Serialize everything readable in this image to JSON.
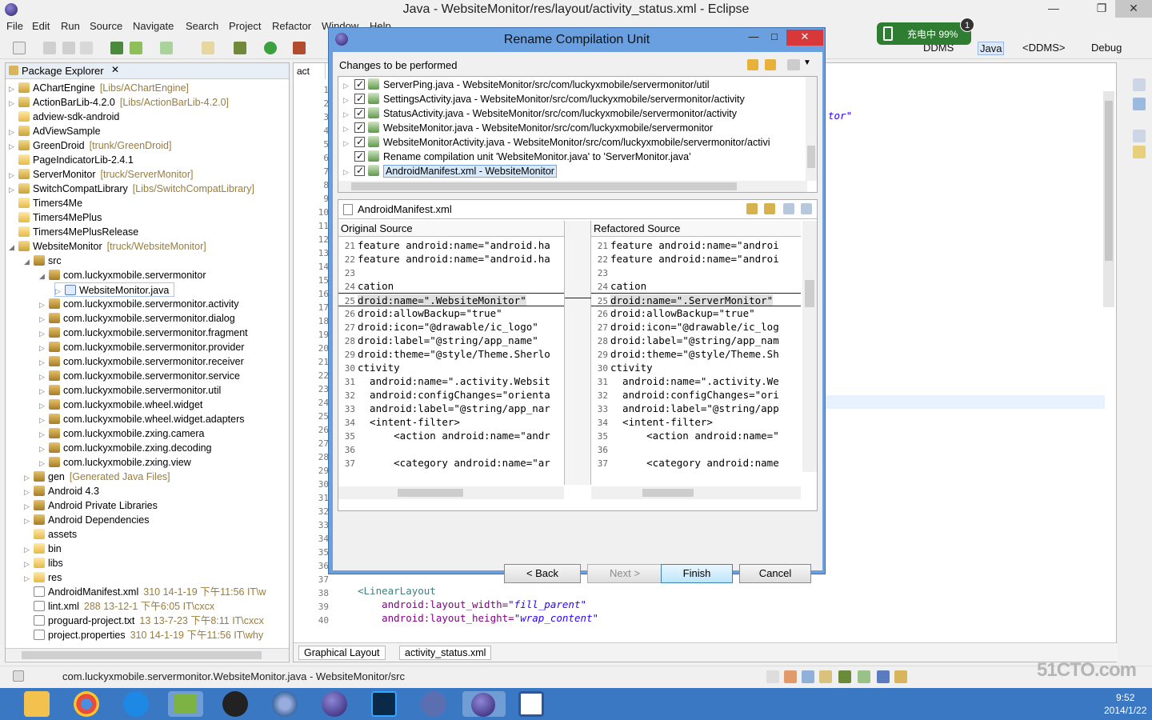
{
  "window": {
    "title": "Java - WebsiteMonitor/res/layout/activity_status.xml - Eclipse",
    "minimize": "—",
    "maximize": "❐",
    "close": "✕"
  },
  "menu": [
    "File",
    "Edit",
    "Run",
    "Source",
    "Navigate",
    "Search",
    "Project",
    "Refactor",
    "Window",
    "Help"
  ],
  "perspectives": [
    "DDMS",
    "Java",
    "<DDMS>",
    "Debug"
  ],
  "battery": {
    "label": "充电中 99%",
    "badge": "1"
  },
  "package_explorer": {
    "title": "Package Explorer",
    "close": "✕",
    "items": [
      {
        "label": "AChartEngine",
        "deco": "[Libs/AChartEngine]",
        "type": "proj",
        "indent": 0,
        "arrow": "▷"
      },
      {
        "label": "ActionBarLib-4.2.0",
        "deco": "[Libs/ActionBarLib-4.2.0]",
        "type": "proj",
        "indent": 0,
        "arrow": "▷"
      },
      {
        "label": "adview-sdk-android",
        "deco": "",
        "type": "folder",
        "indent": 0,
        "arrow": ""
      },
      {
        "label": "AdViewSample",
        "deco": "",
        "type": "proj",
        "indent": 0,
        "arrow": "▷"
      },
      {
        "label": "GreenDroid",
        "deco": "[trunk/GreenDroid]",
        "type": "proj",
        "indent": 0,
        "arrow": "▷"
      },
      {
        "label": "PageIndicatorLib-2.4.1",
        "deco": "",
        "type": "folder",
        "indent": 0,
        "arrow": ""
      },
      {
        "label": "ServerMonitor",
        "deco": "[truck/ServerMonitor]",
        "type": "proj",
        "indent": 0,
        "arrow": "▷"
      },
      {
        "label": "SwitchCompatLibrary",
        "deco": "[Libs/SwitchCompatLibrary]",
        "type": "proj",
        "indent": 0,
        "arrow": "▷"
      },
      {
        "label": "Timers4Me",
        "deco": "",
        "type": "folder",
        "indent": 0,
        "arrow": ""
      },
      {
        "label": "Timers4MePlus",
        "deco": "",
        "type": "folder",
        "indent": 0,
        "arrow": ""
      },
      {
        "label": "Timers4MePlusRelease",
        "deco": "",
        "type": "folder",
        "indent": 0,
        "arrow": ""
      },
      {
        "label": "WebsiteMonitor",
        "deco": "[truck/WebsiteMonitor]",
        "type": "proj",
        "indent": 0,
        "arrow": "◢"
      },
      {
        "label": "src",
        "deco": "",
        "type": "pkg",
        "indent": 1,
        "arrow": "◢"
      },
      {
        "label": "com.luckyxmobile.servermonitor",
        "deco": "",
        "type": "pkg",
        "indent": 2,
        "arrow": "◢"
      },
      {
        "label": "WebsiteMonitor.java",
        "deco": "",
        "type": "java",
        "indent": 3,
        "arrow": "▷",
        "selected": true
      },
      {
        "label": "com.luckyxmobile.servermonitor.activity",
        "deco": "",
        "type": "pkg",
        "indent": 2,
        "arrow": "▷"
      },
      {
        "label": "com.luckyxmobile.servermonitor.dialog",
        "deco": "",
        "type": "pkg",
        "indent": 2,
        "arrow": "▷"
      },
      {
        "label": "com.luckyxmobile.servermonitor.fragment",
        "deco": "",
        "type": "pkg",
        "indent": 2,
        "arrow": "▷"
      },
      {
        "label": "com.luckyxmobile.servermonitor.provider",
        "deco": "",
        "type": "pkg",
        "indent": 2,
        "arrow": "▷"
      },
      {
        "label": "com.luckyxmobile.servermonitor.receiver",
        "deco": "",
        "type": "pkg",
        "indent": 2,
        "arrow": "▷"
      },
      {
        "label": "com.luckyxmobile.servermonitor.service",
        "deco": "",
        "type": "pkg",
        "indent": 2,
        "arrow": "▷"
      },
      {
        "label": "com.luckyxmobile.servermonitor.util",
        "deco": "",
        "type": "pkg",
        "indent": 2,
        "arrow": "▷"
      },
      {
        "label": "com.luckyxmobile.wheel.widget",
        "deco": "",
        "type": "pkg",
        "indent": 2,
        "arrow": "▷"
      },
      {
        "label": "com.luckyxmobile.wheel.widget.adapters",
        "deco": "",
        "type": "pkg",
        "indent": 2,
        "arrow": "▷"
      },
      {
        "label": "com.luckyxmobile.zxing.camera",
        "deco": "",
        "type": "pkg",
        "indent": 2,
        "arrow": "▷"
      },
      {
        "label": "com.luckyxmobile.zxing.decoding",
        "deco": "",
        "type": "pkg",
        "indent": 2,
        "arrow": "▷"
      },
      {
        "label": "com.luckyxmobile.zxing.view",
        "deco": "",
        "type": "pkg",
        "indent": 2,
        "arrow": "▷"
      },
      {
        "label": "gen",
        "deco": "[Generated Java Files]",
        "type": "pkg",
        "indent": 1,
        "arrow": "▷"
      },
      {
        "label": "Android 4.3",
        "deco": "",
        "type": "pkg",
        "indent": 1,
        "arrow": "▷"
      },
      {
        "label": "Android Private Libraries",
        "deco": "",
        "type": "pkg",
        "indent": 1,
        "arrow": "▷"
      },
      {
        "label": "Android Dependencies",
        "deco": "",
        "type": "pkg",
        "indent": 1,
        "arrow": "▷"
      },
      {
        "label": "assets",
        "deco": "",
        "type": "folder",
        "indent": 1,
        "arrow": ""
      },
      {
        "label": "bin",
        "deco": "",
        "type": "folder",
        "indent": 1,
        "arrow": "▷"
      },
      {
        "label": "libs",
        "deco": "",
        "type": "folder",
        "indent": 1,
        "arrow": "▷"
      },
      {
        "label": "res",
        "deco": "",
        "type": "folder",
        "indent": 1,
        "arrow": "▷"
      },
      {
        "label": "AndroidManifest.xml",
        "deco": "310  14-1-19 下午11:56  IT\\w",
        "type": "file",
        "indent": 1,
        "arrow": ""
      },
      {
        "label": "lint.xml",
        "deco": "288  13-12-1 下午6:05  IT\\cxcx",
        "type": "file",
        "indent": 1,
        "arrow": ""
      },
      {
        "label": "proguard-project.txt",
        "deco": "13  13-7-23 下午8:11  IT\\cxcx",
        "type": "file",
        "indent": 1,
        "arrow": ""
      },
      {
        "label": "project.properties",
        "deco": "310  14-1-19 下午11:56  IT\\why",
        "type": "file",
        "indent": 1,
        "arrow": ""
      }
    ]
  },
  "editor": {
    "tab_label": "act",
    "line_numbers": [
      "1",
      "2",
      "3",
      "4",
      "5",
      "6",
      "7",
      "8",
      "9",
      "10",
      "11",
      "12",
      "13",
      "14",
      "15",
      "16",
      "17",
      "18",
      "19",
      "20",
      "21",
      "22",
      "23",
      "24",
      "25",
      "26",
      "27",
      "28",
      "29",
      "30",
      "31",
      "32",
      "33",
      "34",
      "35",
      "36",
      "37",
      "38",
      "39",
      "40"
    ],
    "fragment": "tor\"",
    "code_lines": [
      {
        "indent": "",
        "tag": "<LinearLayout",
        "attr": "",
        "val": ""
      },
      {
        "indent": "    ",
        "tag": "",
        "attr": "android:layout_width=",
        "val": "\"fill_parent\""
      },
      {
        "indent": "    ",
        "tag": "",
        "attr": "android:layout_height=",
        "val": "\"wrap_content\""
      }
    ],
    "bottom_tabs": [
      "Graphical Layout",
      "activity_status.xml"
    ]
  },
  "dialog": {
    "title": "Rename Compilation Unit",
    "minimize": "—",
    "maximize": "□",
    "close": "✕",
    "changes_label": "Changes to be performed",
    "changes": [
      {
        "label": "ServerPing.java - WebsiteMonitor/src/com/luckyxmobile/servermonitor/util",
        "arrow": "▷"
      },
      {
        "label": "SettingsActivity.java - WebsiteMonitor/src/com/luckyxmobile/servermonitor/activity",
        "arrow": "▷"
      },
      {
        "label": "StatusActivity.java - WebsiteMonitor/src/com/luckyxmobile/servermonitor/activity",
        "arrow": "▷"
      },
      {
        "label": "WebsiteMonitor.java - WebsiteMonitor/src/com/luckyxmobile/servermonitor",
        "arrow": "▷"
      },
      {
        "label": "WebsiteMonitorActivity.java - WebsiteMonitor/src/com/luckyxmobile/servermonitor/activi",
        "arrow": "▷"
      },
      {
        "label": "Rename compilation unit 'WebsiteMonitor.java' to 'ServerMonitor.java'",
        "arrow": ""
      },
      {
        "label": "AndroidManifest.xml - WebsiteMonitor",
        "arrow": "▷",
        "selected": true
      }
    ],
    "preview_file": "AndroidManifest.xml",
    "original_header": "Original Source",
    "refactored_header": "Refactored Source",
    "original_lines": [
      {
        "n": "21",
        "t": "feature android:name=\"android.ha"
      },
      {
        "n": "22",
        "t": "feature android:name=\"android.ha"
      },
      {
        "n": "23",
        "t": ""
      },
      {
        "n": "24",
        "t": "cation"
      },
      {
        "n": "25",
        "t": "droid:name=\".WebsiteMonitor\"",
        "hl": true
      },
      {
        "n": "26",
        "t": "droid:allowBackup=\"true\""
      },
      {
        "n": "27",
        "t": "droid:icon=\"@drawable/ic_logo\""
      },
      {
        "n": "28",
        "t": "droid:label=\"@string/app_name\""
      },
      {
        "n": "29",
        "t": "droid:theme=\"@style/Theme.Sherlo"
      },
      {
        "n": "30",
        "t": "ctivity"
      },
      {
        "n": "31",
        "t": "  android:name=\".activity.Websit"
      },
      {
        "n": "32",
        "t": "  android:configChanges=\"orienta"
      },
      {
        "n": "33",
        "t": "  android:label=\"@string/app_nar"
      },
      {
        "n": "34",
        "t": "  <intent-filter>"
      },
      {
        "n": "35",
        "t": "      <action android:name=\"andr"
      },
      {
        "n": "36",
        "t": ""
      },
      {
        "n": "37",
        "t": "      <category android:name=\"ar"
      }
    ],
    "refactored_lines": [
      {
        "n": "21",
        "t": "feature android:name=\"androi"
      },
      {
        "n": "22",
        "t": "feature android:name=\"androi"
      },
      {
        "n": "23",
        "t": ""
      },
      {
        "n": "24",
        "t": "cation"
      },
      {
        "n": "25",
        "t": "droid:name=\".ServerMonitor\"",
        "hl": true
      },
      {
        "n": "26",
        "t": "droid:allowBackup=\"true\""
      },
      {
        "n": "27",
        "t": "droid:icon=\"@drawable/ic_log"
      },
      {
        "n": "28",
        "t": "droid:label=\"@string/app_nam"
      },
      {
        "n": "29",
        "t": "droid:theme=\"@style/Theme.Sh"
      },
      {
        "n": "30",
        "t": "ctivity"
      },
      {
        "n": "31",
        "t": "  android:name=\".activity.We"
      },
      {
        "n": "32",
        "t": "  android:configChanges=\"ori"
      },
      {
        "n": "33",
        "t": "  android:label=\"@string/app"
      },
      {
        "n": "34",
        "t": "  <intent-filter>"
      },
      {
        "n": "35",
        "t": "      <action android:name=\""
      },
      {
        "n": "36",
        "t": ""
      },
      {
        "n": "37",
        "t": "      <category android:name"
      }
    ],
    "buttons": {
      "back": "< Back",
      "next": "Next >",
      "finish": "Finish",
      "cancel": "Cancel"
    }
  },
  "statusbar": {
    "message": "com.luckyxmobile.servermonitor.WebsiteMonitor.java - WebsiteMonitor/src"
  },
  "taskbar": {
    "time": "9:52",
    "date": "2014/1/22"
  },
  "watermark": "51CTO.com"
}
